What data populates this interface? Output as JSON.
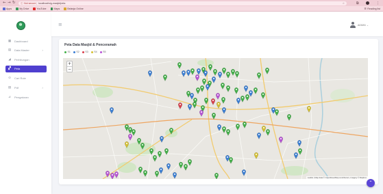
{
  "browser": {
    "security_label": "Not secure",
    "url": "localhost/sig-masjid/peta",
    "bookmarks": [
      {
        "label": "Apps",
        "icon": "apps-grid-icon",
        "color": "#5b6bd6"
      },
      {
        "label": "My Drive",
        "icon": "drive-icon",
        "color": "#3a9a5c"
      },
      {
        "label": "YouTube",
        "icon": "youtube-icon",
        "color": "#e02b2b"
      },
      {
        "label": "Maps",
        "icon": "maps-icon",
        "color": "#2f8f4e"
      },
      {
        "label": "Belanja Online",
        "icon": "bookmark-icon",
        "color": "#d9a62b"
      }
    ],
    "reading_list": "Reading list"
  },
  "sidebar": {
    "logo_icon": "app-logo-icon",
    "items": [
      {
        "label": "Dashboard",
        "icon": "dashboard-icon"
      },
      {
        "label": "Data Master",
        "icon": "database-icon"
      },
      {
        "label": "Perhitungan",
        "icon": "chart-icon"
      },
      {
        "label": "Peta",
        "icon": "map-icon",
        "active": true
      },
      {
        "label": "Cari Rute",
        "icon": "route-icon"
      },
      {
        "label": "Pdf",
        "icon": "file-icon"
      },
      {
        "label": "Pengaturan",
        "icon": "settings-icon"
      }
    ]
  },
  "header": {
    "menu_icon": "hamburger-icon",
    "user": "ADMIN"
  },
  "page": {
    "title": "Peta Data Masjid & Penceramah",
    "legend": [
      {
        "label": "S1",
        "color": "#43b049"
      },
      {
        "label": "S2",
        "color": "#3b7fd4"
      },
      {
        "label": "S3",
        "color": "#d93f4c"
      },
      {
        "label": "S4",
        "color": "#d6c232"
      },
      {
        "label": "S5",
        "color": "#b853d6"
      }
    ]
  },
  "map": {
    "zoom_in": "+",
    "zoom_out": "−",
    "attribution": "Leaflet | Map data © OpenStreetMap contributors, Imagery © Mapbox",
    "marker_categories": [
      0,
      1,
      1,
      0,
      1,
      0,
      1,
      4,
      0,
      0,
      1,
      0,
      0,
      0,
      0,
      1,
      0,
      0,
      0,
      0,
      0,
      1,
      0,
      1,
      0,
      0,
      0,
      0,
      1,
      1,
      0,
      0,
      0,
      0,
      0,
      1,
      0,
      0,
      4,
      2,
      3,
      0,
      1,
      2,
      1,
      0,
      0,
      4,
      0,
      1,
      1,
      1,
      0,
      0,
      3,
      0,
      0,
      0,
      4,
      3,
      0,
      0,
      0,
      1,
      1,
      0,
      0,
      0,
      0,
      3,
      0,
      1,
      4,
      0,
      0,
      0,
      0,
      0,
      0,
      0,
      1,
      1,
      0,
      3,
      1,
      0,
      1,
      0,
      0,
      0,
      1,
      4,
      4,
      4,
      1,
      0,
      1
    ]
  },
  "colors": {
    "accent": "#4f3fcf",
    "fab": "#5a45d6",
    "logo": "#2f9b5a"
  }
}
